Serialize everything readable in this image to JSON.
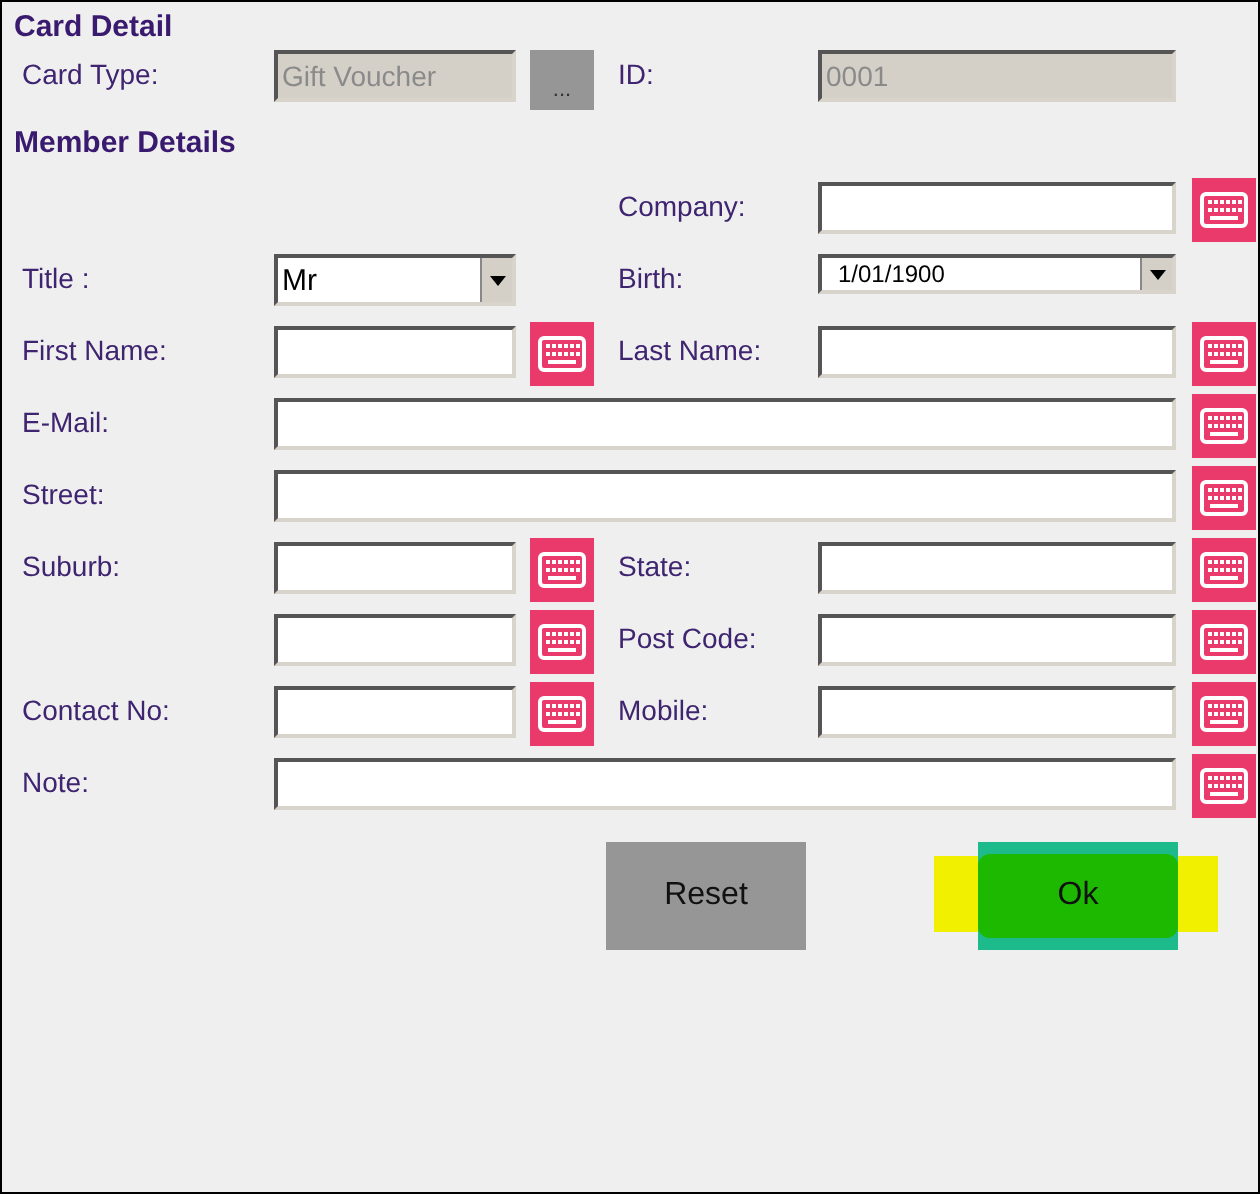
{
  "card_detail": {
    "title": "Card Detail",
    "card_type": {
      "label": "Card Type:",
      "value": "Gift Voucher",
      "disabled": true,
      "browse": "..."
    },
    "id": {
      "label": "ID:",
      "value": "0001",
      "disabled": true
    }
  },
  "member_details": {
    "title": "Member Details",
    "rows": [
      {
        "right": {
          "label": "Company:",
          "kind": "text"
        }
      },
      {
        "left": {
          "label": "Title :",
          "kind": "select",
          "value": "Mr"
        },
        "right": {
          "label": "Birth:",
          "kind": "select",
          "value": "1/01/1900"
        }
      },
      {
        "left": {
          "label": "First Name:",
          "kind": "text"
        },
        "right": {
          "label": "Last Name:",
          "kind": "text"
        }
      },
      {
        "full": {
          "label": "E-Mail:",
          "kind": "text"
        }
      },
      {
        "full": {
          "label": "Street:",
          "kind": "text"
        }
      },
      {
        "left": {
          "label": "Suburb:",
          "kind": "text"
        },
        "right": {
          "label": "State:",
          "kind": "text"
        }
      },
      {
        "left": {
          "kind": "text"
        },
        "right": {
          "label": "Post Code:",
          "kind": "text"
        }
      },
      {
        "left": {
          "label": "Contact No:",
          "kind": "text"
        },
        "right": {
          "label": "Mobile:",
          "kind": "text"
        }
      },
      {
        "full": {
          "label": "Note:",
          "kind": "text"
        }
      }
    ]
  },
  "buttons": [
    {
      "label": "Reset",
      "highlighted": false
    },
    {
      "label": "Ok",
      "highlighted": true
    }
  ]
}
